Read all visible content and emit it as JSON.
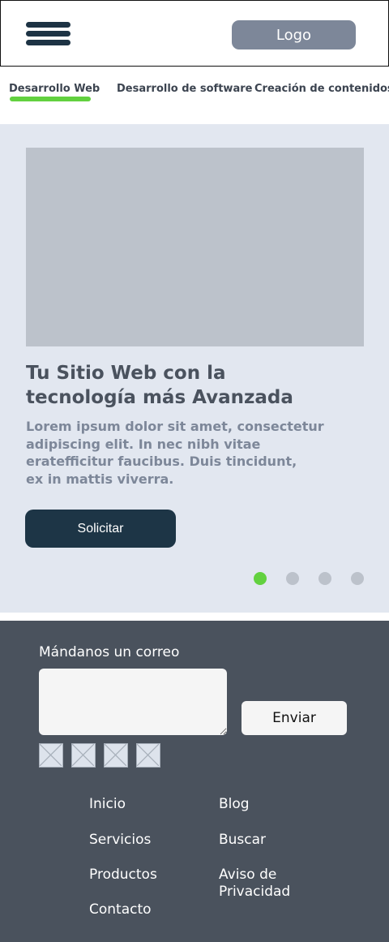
{
  "header": {
    "logo": "Logo"
  },
  "tabs": [
    {
      "label": "Desarrollo Web",
      "active": true
    },
    {
      "label": "Desarrollo de software",
      "active": false
    },
    {
      "label": "Creación de contenidos",
      "active": false
    }
  ],
  "hero": {
    "title_line1": "Tu Sitio Web con la",
    "title_line2": "tecnología más Avanzada",
    "text_line1": "Lorem ipsum dolor sit amet, consectetur",
    "text_line2": "adipiscing elit. In nec nibh vitae",
    "text_line3": "eratefficitur faucibus. Duis tincidunt,",
    "text_line4": "ex in mattis viverra.",
    "cta_label": "Solicitar",
    "slides_total": 4,
    "active_slide": 1
  },
  "footer": {
    "mail_label": "Mándanos un correo",
    "send_label": "Enviar",
    "social_icons": [
      "image-placeholder-icon",
      "image-placeholder-icon",
      "image-placeholder-icon",
      "image-placeholder-icon"
    ],
    "links_left": [
      "Inicio",
      "Servicios",
      "Productos",
      "Contacto"
    ],
    "links_right": [
      "Blog",
      "Buscar",
      "Aviso de",
      "Privacidad"
    ]
  },
  "colors": {
    "accent": "#62d13f",
    "primary_dark": "#1d3546",
    "hero_bg": "#e2e7f0",
    "footer_bg": "#4a525d",
    "logo_bg": "#7d8799"
  }
}
